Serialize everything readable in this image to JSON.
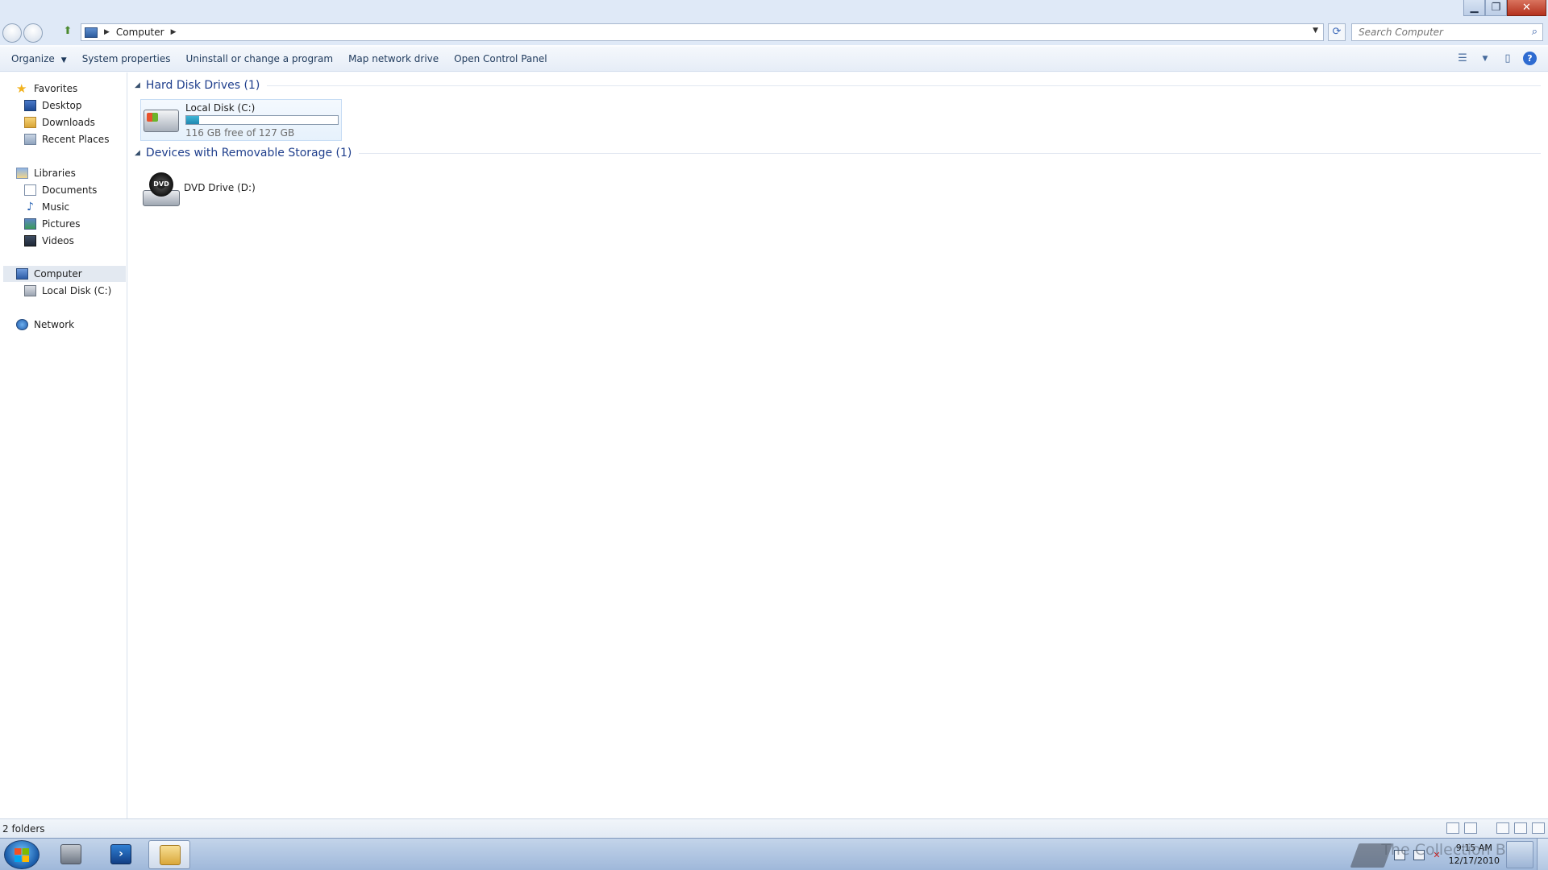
{
  "window": {
    "minimize": "▁",
    "maximize": "❐",
    "close": "✕"
  },
  "address": {
    "segments": [
      "Computer"
    ],
    "search_placeholder": "Search Computer"
  },
  "toolbar": {
    "organize": "Organize",
    "system_properties": "System properties",
    "uninstall": "Uninstall or change a program",
    "map_drive": "Map network drive",
    "control_panel": "Open Control Panel"
  },
  "navpane": {
    "favorites": "Favorites",
    "desktop": "Desktop",
    "downloads": "Downloads",
    "recent": "Recent Places",
    "libraries": "Libraries",
    "documents": "Documents",
    "music": "Music",
    "pictures": "Pictures",
    "videos": "Videos",
    "computer": "Computer",
    "local_disk": "Local Disk (C:)",
    "network": "Network"
  },
  "content": {
    "group_hdd": "Hard Disk Drives (1)",
    "disk_name": "Local Disk (C:)",
    "disk_used_fraction": 0.087,
    "disk_free": "116 GB free of 127 GB",
    "group_removable": "Devices with Removable Storage (1)",
    "dvd_name": "DVD Drive (D:)",
    "dvd_label": "DVD"
  },
  "status": {
    "count": "2 folders"
  },
  "taskbar": {
    "ps_glyph": "›",
    "time": "9:15 AM",
    "date": "12/17/2010",
    "watermark": "The Collection Book"
  },
  "colors": {
    "accent": "#1e3e8c",
    "bar_fill": "#1f87b0"
  }
}
